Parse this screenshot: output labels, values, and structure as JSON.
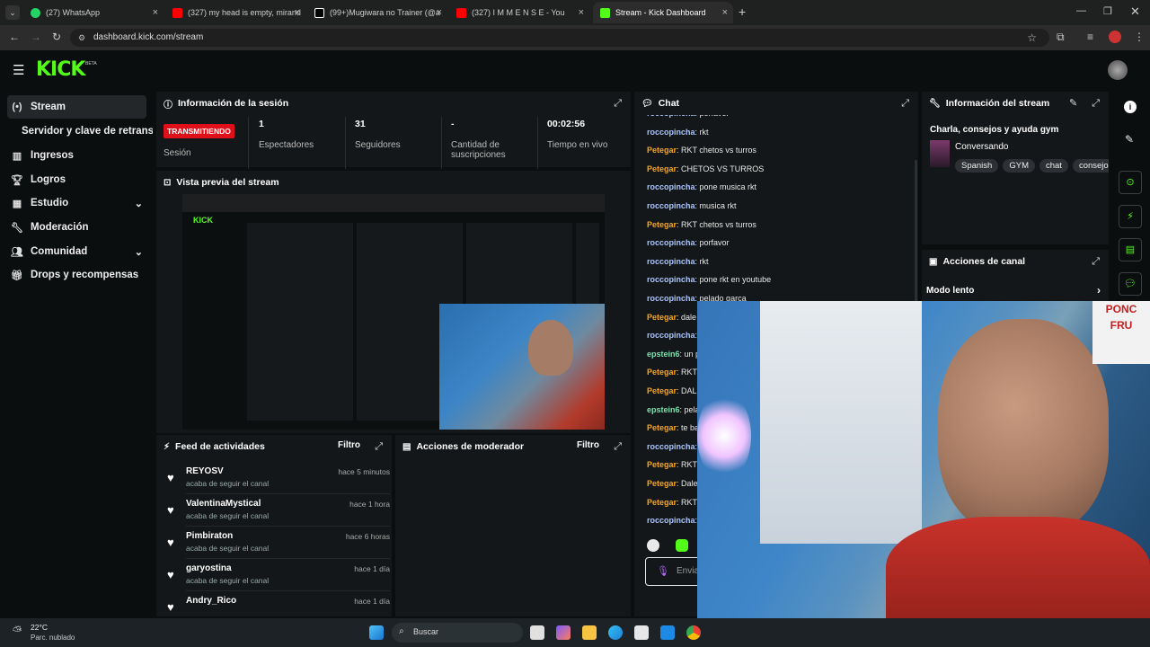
{
  "browser": {
    "tabs": [
      {
        "label": "(27) WhatsApp",
        "color": "#25d366"
      },
      {
        "label": "(327) my head is empty, mirand",
        "color": "#ff0000"
      },
      {
        "label": "(99+)Mugiwara no Trainer (@a",
        "color": "#ffffff"
      },
      {
        "label": "(327)  I  M M E N S E  - You",
        "color": "#ff0000"
      },
      {
        "label": "Stream - Kick Dashboard",
        "color": "#53fc18"
      }
    ],
    "url": "dashboard.kick.com/stream"
  },
  "app": {
    "logo": "KICK",
    "logo_badge": "BETA",
    "accent": "#53fc18"
  },
  "sidebar": {
    "items": [
      {
        "label": "Stream",
        "icon": "broadcast-icon"
      },
      {
        "label": "Servidor y clave de retransmisión"
      },
      {
        "label": "Ingresos",
        "icon": "chart-icon"
      },
      {
        "label": "Logros",
        "icon": "trophy-icon"
      },
      {
        "label": "Estudio",
        "icon": "studio-icon"
      },
      {
        "label": "Moderación",
        "icon": "wrench-icon"
      },
      {
        "label": "Comunidad",
        "icon": "community-icon"
      },
      {
        "label": "Drops y recompensas",
        "icon": "gift-icon"
      }
    ]
  },
  "session": {
    "title": "Información de la sesión",
    "live_badge": "TRANSMITIENDO",
    "session_label": "Sesión",
    "stats": [
      {
        "value": "1",
        "label": "Espectadores"
      },
      {
        "value": "31",
        "label": "Seguidores"
      },
      {
        "value": "-",
        "label": "Cantidad de suscripciones"
      },
      {
        "value": "00:02:56",
        "label": "Tiempo en vivo"
      }
    ]
  },
  "preview": {
    "title": "Vista previa del stream"
  },
  "feed": {
    "title": "Feed de actividades",
    "filter": "Filtro",
    "items": [
      {
        "name": "REYOSV",
        "sub": "acaba de seguir el canal",
        "time": "hace 5 minutos"
      },
      {
        "name": "ValentinaMystical",
        "sub": "acaba de seguir el canal",
        "time": "hace 1 hora"
      },
      {
        "name": "Pimbiraton",
        "sub": "acaba de seguir el canal",
        "time": "hace 6 horas"
      },
      {
        "name": "garyostina",
        "sub": "acaba de seguir el canal",
        "time": "hace 1 día"
      },
      {
        "name": "Andry_Rico",
        "sub": "",
        "time": "hace 1 día"
      }
    ]
  },
  "mod_actions": {
    "title": "Acciones de moderador",
    "filter": "Filtro"
  },
  "chat": {
    "title": "Chat",
    "messages": [
      {
        "user": "roccopincha",
        "text": "porfavor",
        "color": "#a9c4ff"
      },
      {
        "user": "roccopincha",
        "text": "rkt",
        "color": "#a9c4ff"
      },
      {
        "user": "Petegar",
        "text": "RKT chetos vs turros",
        "color": "#f5a623"
      },
      {
        "user": "Petegar",
        "text": "CHETOS VS TURROS",
        "color": "#f5a623"
      },
      {
        "user": "roccopincha",
        "text": "pone musica rkt",
        "color": "#a9c4ff"
      },
      {
        "user": "roccopincha",
        "text": "musica rkt",
        "color": "#a9c4ff"
      },
      {
        "user": "Petegar",
        "text": "RKT chetos vs turros",
        "color": "#f5a623"
      },
      {
        "user": "roccopincha",
        "text": "porfavor",
        "color": "#a9c4ff"
      },
      {
        "user": "roccopincha",
        "text": "rkt",
        "color": "#a9c4ff"
      },
      {
        "user": "roccopincha",
        "text": "pone rkt en youtube",
        "color": "#a9c4ff"
      },
      {
        "user": "roccopincha",
        "text": "pelado garca",
        "color": "#a9c4ff"
      },
      {
        "user": "Petegar",
        "text": "dale",
        "color": "#f5a623"
      },
      {
        "user": "roccopincha",
        "text": "",
        "color": "#a9c4ff"
      },
      {
        "user": "epstein6",
        "text": "un p",
        "color": "#7ee0b0"
      },
      {
        "user": "Petegar",
        "text": "RKT",
        "color": "#f5a623"
      },
      {
        "user": "Petegar",
        "text": "DALE",
        "color": "#f5a623"
      },
      {
        "user": "epstein6",
        "text": "pela",
        "color": "#7ee0b0"
      },
      {
        "user": "Petegar",
        "text": "te ba",
        "color": "#f5a623"
      },
      {
        "user": "roccopincha",
        "text": "",
        "color": "#a9c4ff"
      },
      {
        "user": "Petegar",
        "text": "RKT",
        "color": "#f5a623"
      },
      {
        "user": "Petegar",
        "text": "Dale",
        "color": "#f5a623"
      },
      {
        "user": "Petegar",
        "text": "RKT",
        "color": "#f5a623"
      },
      {
        "user": "roccopincha",
        "text": "",
        "color": "#a9c4ff"
      }
    ],
    "input_placeholder": "Envia"
  },
  "stream_info": {
    "title": "Información del stream",
    "stream_title": "Charla, consejos y ayuda gym",
    "category": "Conversando",
    "tags": [
      "Spanish",
      "GYM",
      "chat",
      "consejo"
    ]
  },
  "channel_actions": {
    "title": "Acciones de canal",
    "slow_mode": "Modo lento"
  },
  "taskbar": {
    "temperature": "22°C",
    "weather": "Parc. nublado",
    "search": "Buscar"
  }
}
